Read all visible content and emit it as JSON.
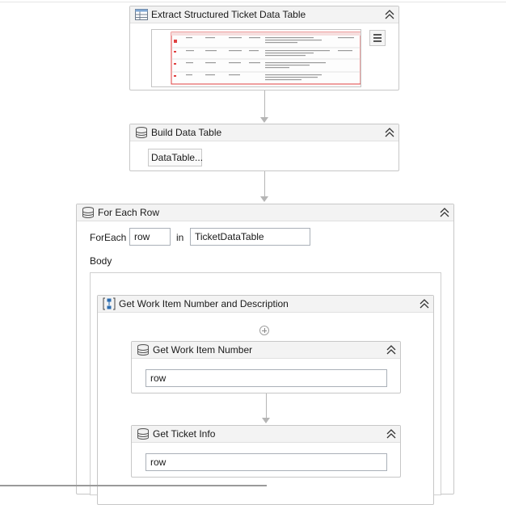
{
  "extract_activity": {
    "title": "Extract Structured Ticket Data Table",
    "icon": "table-extract-icon"
  },
  "build_activity": {
    "title": "Build Data Table",
    "button_label": "DataTable...",
    "icon": "data-table-icon"
  },
  "foreach_activity": {
    "title": "For Each Row",
    "foreach_label": "ForEach",
    "item_value": "row",
    "in_label": "in",
    "collection_value": "TicketDataTable",
    "body_label": "Body",
    "icon": "for-each-icon"
  },
  "sequence_activity": {
    "title": "Get Work Item Number and Description",
    "icon": "sequence-icon"
  },
  "work_item_activity": {
    "title": "Get Work Item Number",
    "value": "row",
    "icon": "data-table-icon"
  },
  "ticket_info_activity": {
    "title": "Get Ticket Info",
    "value": "row",
    "icon": "data-table-icon"
  },
  "icons": {
    "collapse": "double-chevron-up-icon",
    "menu": "hamburger-menu-icon",
    "add": "add-activity-icon"
  },
  "colors": {
    "header_bg": "#f3f3f3",
    "border": "#c7c7c7",
    "connector": "#b5b5b5",
    "icon_blue": "#2b6cb0"
  }
}
